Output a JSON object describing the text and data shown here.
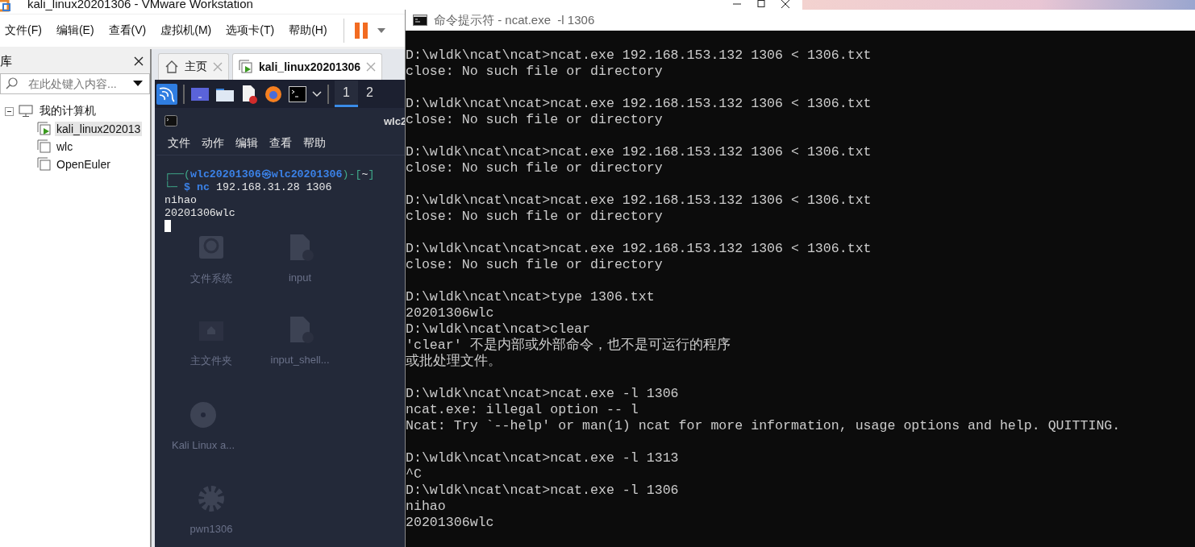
{
  "vmware": {
    "title": "kali_linux20201306 - VMware Workstation",
    "menu": [
      "文件(F)",
      "编辑(E)",
      "查看(V)",
      "虚拟机(M)",
      "选项卡(T)",
      "帮助(H)"
    ],
    "library": {
      "title": "库",
      "search": {
        "placeholder": "在此处键入内容..."
      },
      "tree": [
        {
          "label": "我的计算机",
          "kind": "computer",
          "expanded": true,
          "selected": false,
          "children": [
            {
              "label": "kali_linux202013",
              "kind": "vm",
              "running": true,
              "selected": true
            },
            {
              "label": "wlc",
              "kind": "vm",
              "running": false,
              "selected": false
            },
            {
              "label": "OpenEuler",
              "kind": "vm",
              "running": false,
              "selected": false
            }
          ]
        }
      ]
    },
    "tabs": [
      {
        "label": "主页",
        "kind": "home",
        "selected": false
      },
      {
        "label": "kali_linux20201306",
        "kind": "vm",
        "selected": true
      }
    ],
    "guest": {
      "workspaces": [
        {
          "label": "1",
          "selected": true
        },
        {
          "label": "2",
          "selected": false
        }
      ],
      "desktop_icons": [
        {
          "label": "文件系统",
          "kind": "disk"
        },
        {
          "label": "input",
          "kind": "locked-file"
        },
        {
          "label": "主文件夹",
          "kind": "home"
        },
        {
          "label": "input_shell...",
          "kind": "locked-file"
        },
        {
          "label": "Kali Linux a...",
          "kind": "disc"
        },
        {
          "label": "pwn1306",
          "kind": "gear"
        }
      ],
      "terminal": {
        "title": "wlc2",
        "menu": [
          "文件",
          "动作",
          "编辑",
          "查看",
          "帮助"
        ],
        "prompt": {
          "open": "┌──(",
          "user": "wlc20201306",
          "at": "㉿",
          "host": "wlc20201306",
          "mid": ")-[",
          "dir": "~",
          "close": "]",
          "corner": "└─",
          "sign": "$",
          "command": "nc",
          "args": "192.168.31.28 1306"
        },
        "output": [
          "nihao",
          "20201306wlc"
        ]
      }
    }
  },
  "cmd": {
    "title": "命令提示符 - ncat.exe  -l 1306",
    "blocks": [
      [
        "D:\\wldk\\ncat\\ncat>ncat.exe 192.168.153.132 1306 < 1306.txt",
        "close: No such file or directory"
      ],
      [
        "D:\\wldk\\ncat\\ncat>ncat.exe 192.168.153.132 1306 < 1306.txt",
        "close: No such file or directory"
      ],
      [
        "D:\\wldk\\ncat\\ncat>ncat.exe 192.168.153.132 1306 < 1306.txt",
        "close: No such file or directory"
      ],
      [
        "D:\\wldk\\ncat\\ncat>ncat.exe 192.168.153.132 1306 < 1306.txt",
        "close: No such file or directory"
      ],
      [
        "D:\\wldk\\ncat\\ncat>ncat.exe 192.168.153.132 1306 < 1306.txt",
        "close: No such file or directory"
      ],
      [
        "D:\\wldk\\ncat\\ncat>type 1306.txt",
        "20201306wlc",
        "D:\\wldk\\ncat\\ncat>clear",
        "'clear' 不是内部或外部命令，也不是可运行的程序",
        "或批处理文件。"
      ],
      [
        "D:\\wldk\\ncat\\ncat>ncat.exe -l 1306",
        "ncat.exe: illegal option -- l",
        "Ncat: Try `--help' or man(1) ncat for more information, usage options and help. QUITTING."
      ],
      [
        "D:\\wldk\\ncat\\ncat>ncat.exe -l 1313",
        "^C",
        "D:\\wldk\\ncat\\ncat>ncat.exe -l 1306",
        "nihao",
        "20201306wlc"
      ]
    ]
  }
}
